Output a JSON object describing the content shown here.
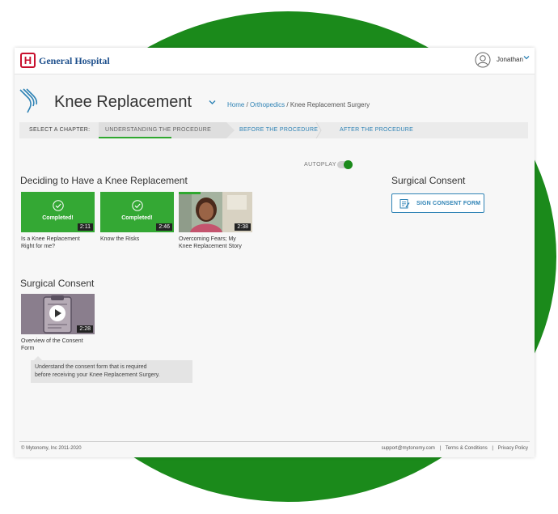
{
  "header": {
    "logo_letter": "H",
    "brand": "General Hospital",
    "user_name": "Jonathan"
  },
  "page": {
    "title": "Knee Replacement",
    "breadcrumb": [
      {
        "label": "Home"
      },
      {
        "label": "Orthopedics"
      },
      {
        "label": "Knee Replacement Surgery"
      }
    ],
    "breadcrumb_sep": "/"
  },
  "chapters": {
    "select_label": "SELECT A CHAPTER:",
    "items": [
      {
        "label": "UNDERSTANDING THE PROCEDURE",
        "active": true
      },
      {
        "label": "BEFORE THE PROCEDURE",
        "active": false
      },
      {
        "label": "AFTER THE PROCEDURE",
        "active": false
      }
    ]
  },
  "autoplay": {
    "label": "AUTOPLAY",
    "on": true
  },
  "sections": [
    {
      "title": "Deciding to Have a Knee Replacement",
      "videos": [
        {
          "title_line1": "Is a Knee Replacement",
          "title_line2": "Right for me?",
          "duration": "2:11",
          "status": "Completed!",
          "thumb_icon": "check-circle-icon"
        },
        {
          "title_line1": "Know the Risks",
          "title_line2": "",
          "duration": "2:46",
          "status": "Completed!",
          "thumb_icon": "check-circle-icon"
        },
        {
          "title_line1": "Overcoming Fears; My",
          "title_line2": "Knee Replacement Story",
          "duration": "2:38",
          "status": "",
          "thumb_icon": "woman-portrait-icon",
          "progress": 0.3
        }
      ]
    },
    {
      "title": "Surgical Consent",
      "videos": [
        {
          "title_line1": "Overview of the Consent",
          "title_line2": "Form",
          "duration": "2:28",
          "status": "",
          "thumb_icon": "clipboard-play-icon"
        }
      ]
    }
  ],
  "tooltip": {
    "line1": "Understand the consent form that is required",
    "line2": "before receiving your Knee Replacement Surgery."
  },
  "sidebar": {
    "title": "Surgical Consent",
    "button_label": "SIGN CONSENT FORM"
  },
  "footer": {
    "copyright": "© Mytonomy, Inc 2011-2020",
    "links": [
      "support@mytonomy.com",
      "Terms & Conditions",
      "Privacy Policy"
    ],
    "sep": "|"
  },
  "colors": {
    "accent_green": "#1b8a1b",
    "thumb_green": "#34a834",
    "link_blue": "#2f83b5",
    "brand_blue": "#1d4f8c",
    "logo_red": "#c8102e"
  }
}
